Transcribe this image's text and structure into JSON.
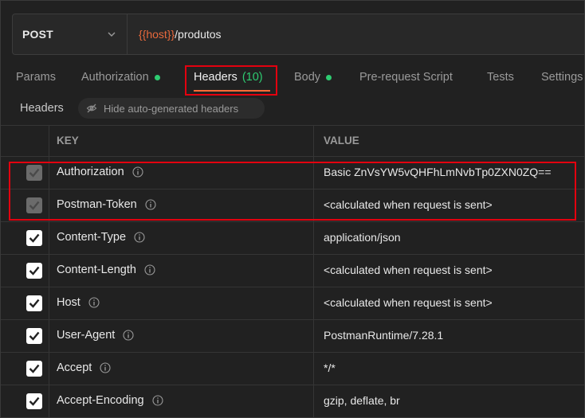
{
  "request": {
    "method": "POST",
    "url_variable": "{{host}}",
    "url_path": "/produtos"
  },
  "tabs": [
    {
      "label": "Params",
      "dot": false,
      "active": false
    },
    {
      "label": "Authorization",
      "dot": true,
      "active": false
    },
    {
      "label": "Headers",
      "count": "(10)",
      "dot": false,
      "active": true
    },
    {
      "label": "Body",
      "dot": true,
      "active": false
    },
    {
      "label": "Pre-request Script",
      "dot": false,
      "active": false
    },
    {
      "label": "Tests",
      "dot": false,
      "active": false
    },
    {
      "label": "Settings",
      "dot": false,
      "active": false
    }
  ],
  "headers_section": {
    "title": "Headers",
    "toggle_label": "Hide auto-generated headers",
    "toggle_icon": "eye-off-icon"
  },
  "table": {
    "columns": [
      "KEY",
      "VALUE"
    ],
    "rows": [
      {
        "key": "Authorization",
        "value": "Basic ZnVsYW5vQHFhLmNvbTp0ZXN0ZQ==",
        "checked": true,
        "disabled": true
      },
      {
        "key": "Postman-Token",
        "value": "<calculated when request is sent>",
        "checked": true,
        "disabled": true
      },
      {
        "key": "Content-Type",
        "value": "application/json",
        "checked": true,
        "disabled": false
      },
      {
        "key": "Content-Length",
        "value": "<calculated when request is sent>",
        "checked": true,
        "disabled": false
      },
      {
        "key": "Host",
        "value": "<calculated when request is sent>",
        "checked": true,
        "disabled": false
      },
      {
        "key": "User-Agent",
        "value": "PostmanRuntime/7.28.1",
        "checked": true,
        "disabled": false
      },
      {
        "key": "Accept",
        "value": "*/*",
        "checked": true,
        "disabled": false
      },
      {
        "key": "Accept-Encoding",
        "value": "gzip, deflate, br",
        "checked": true,
        "disabled": false
      }
    ]
  },
  "colors": {
    "background": "#212121",
    "accent": "#ff6c37",
    "variable": "#e8693c",
    "status_dot": "#2ecc71",
    "highlight_box": "#e3000f"
  }
}
